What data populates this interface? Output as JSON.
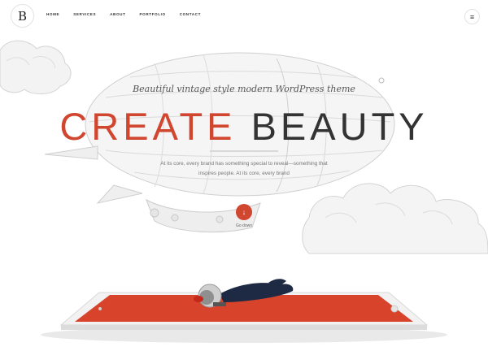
{
  "brand": {
    "logo_letter": "B"
  },
  "nav": {
    "items": [
      "HOME",
      "SERVICES",
      "ABOUT",
      "PORTFOLIO",
      "CONTACT"
    ]
  },
  "menu": {
    "icon": "hamburger-icon"
  },
  "hero": {
    "tagline": "Beautiful vintage style modern WordPress theme",
    "headline_accent": "CREATE",
    "headline_main": "BEAUTY",
    "intro_line1": "At its core, every brand has something special to reveal—something that",
    "intro_line2": "inspires people. At its core, every brand",
    "go_down_label": "Go down",
    "go_down_icon": "arrow-down-icon"
  },
  "colors": {
    "accent": "#d1462f",
    "text": "#333333",
    "sketch": "#cfcfcf"
  }
}
